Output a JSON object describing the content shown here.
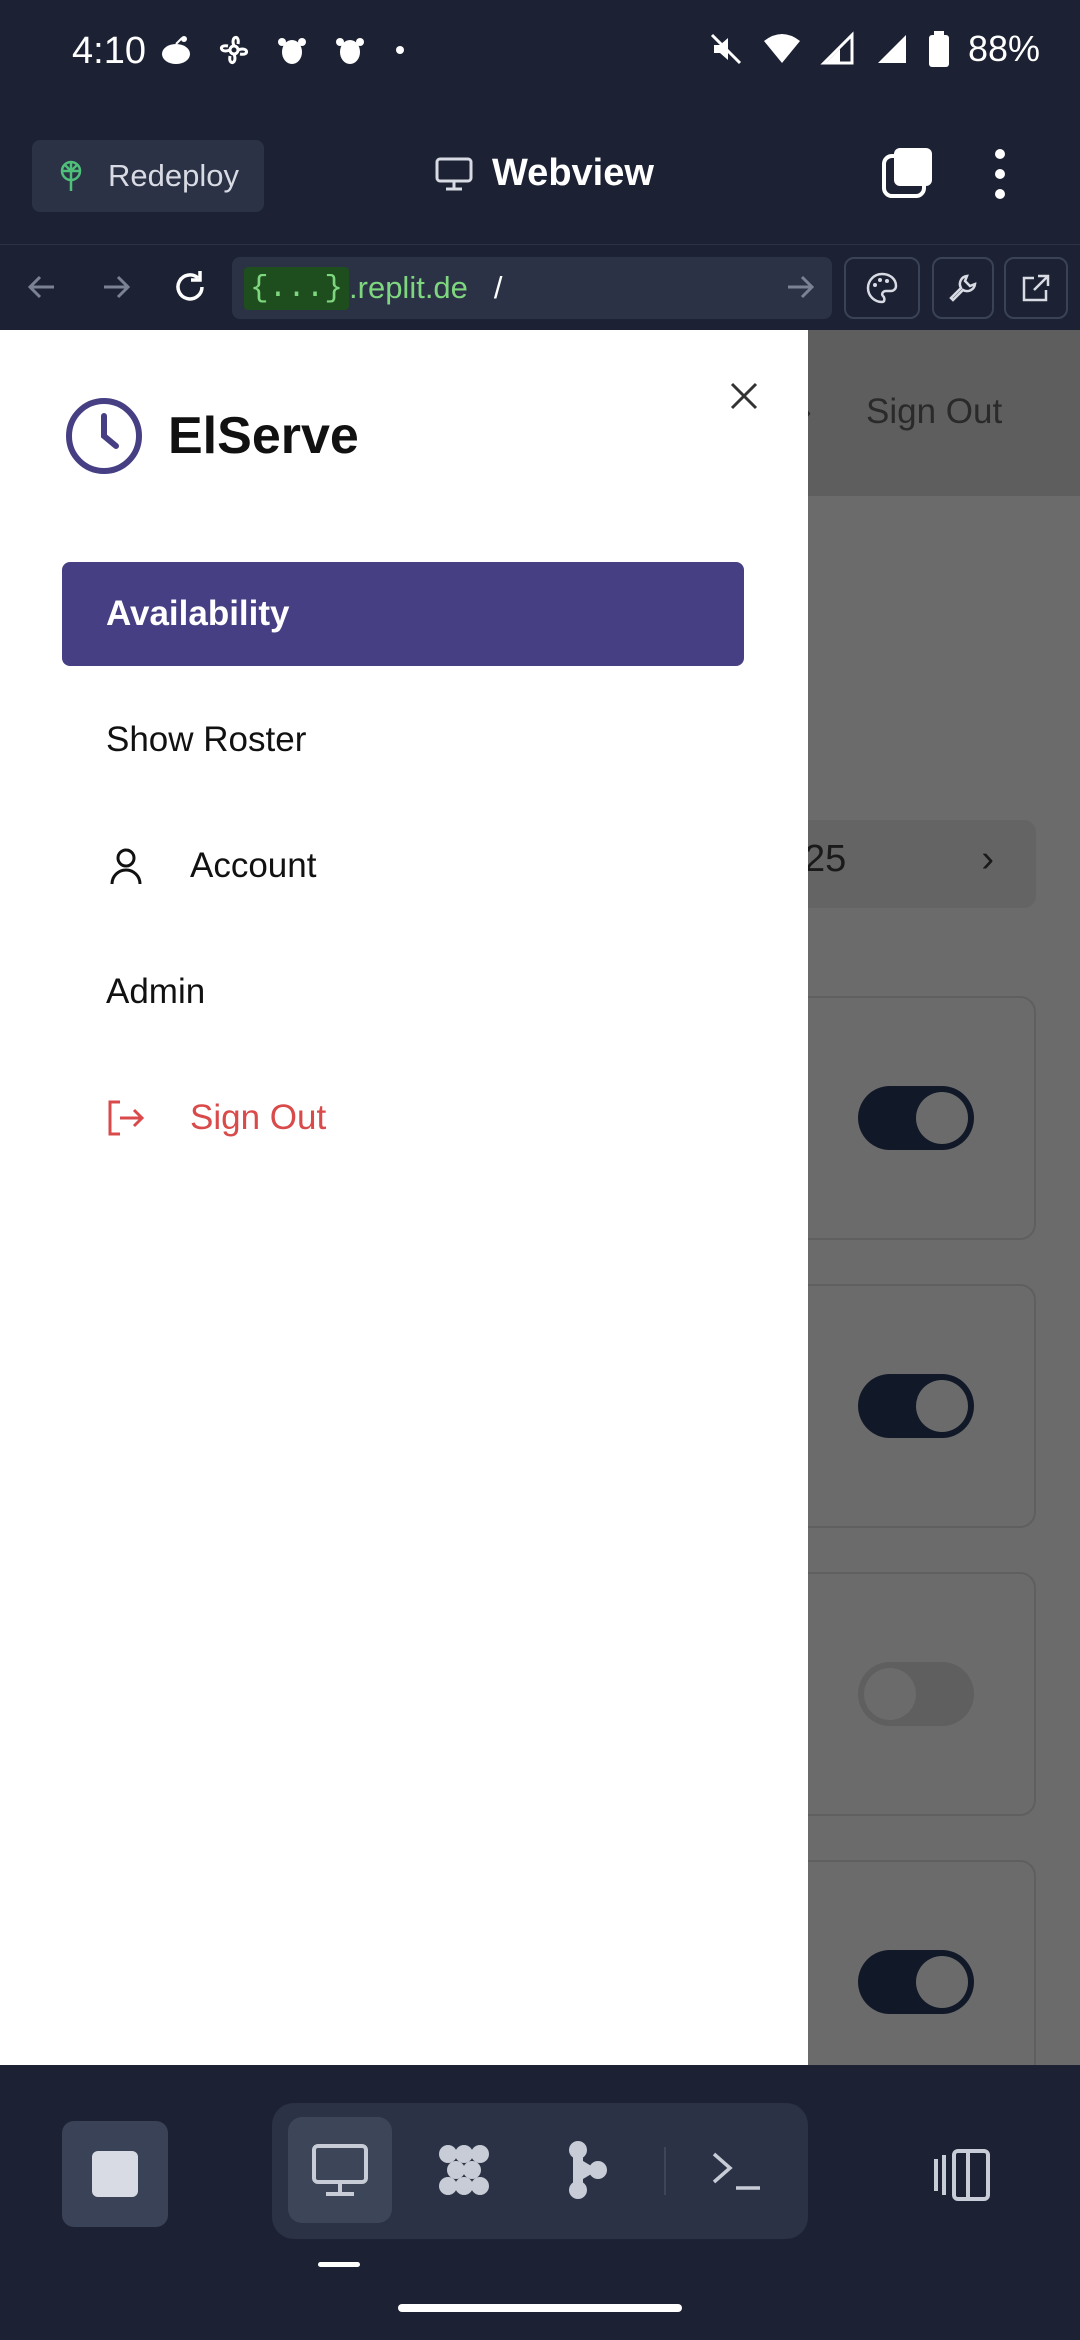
{
  "status_bar": {
    "time": "4:10",
    "battery": "88%",
    "left_icons": [
      "reddit-icon",
      "fan-icon",
      "bug-icon",
      "bug-icon",
      "dot-icon"
    ],
    "right_icons": [
      "mute-icon",
      "wifi-icon",
      "signal-icon",
      "signal-icon",
      "battery-icon"
    ]
  },
  "replit_header": {
    "redeploy_label": "Redeploy",
    "webview_label": "Webview"
  },
  "url_bar": {
    "host_badge": "{...}",
    "host": ".replit.de",
    "path": "/"
  },
  "background_page": {
    "header_signout": "Sign Out",
    "date_fragment": "25",
    "toggles": [
      true,
      true,
      false,
      true
    ]
  },
  "drawer": {
    "brand": "ElServe",
    "menu": [
      {
        "label": "Availability",
        "active": true
      },
      {
        "label": "Show Roster"
      },
      {
        "label": "Account",
        "icon": "user-icon"
      },
      {
        "label": "Admin"
      },
      {
        "label": "Sign Out",
        "icon": "sign-out-icon",
        "danger": true
      }
    ]
  },
  "bottom_nav": {
    "tools": [
      "webview-icon",
      "workspace-icon",
      "git-icon",
      "console-icon"
    ],
    "active_tool": "webview-icon"
  },
  "colors": {
    "accent": "#463f84",
    "danger": "#d94a4a",
    "chrome_bg": "#1c2233",
    "url_green": "#7ed67e"
  }
}
